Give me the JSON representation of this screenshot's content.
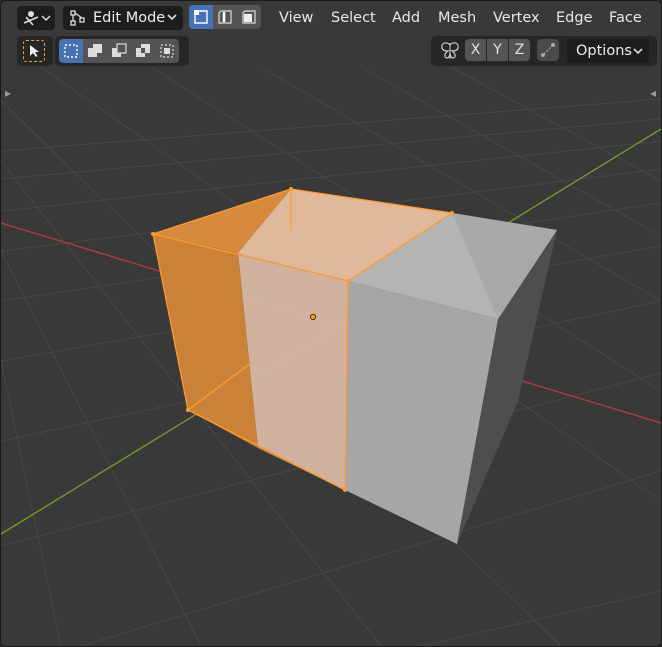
{
  "header": {
    "mode_label": "Edit Mode",
    "menus": [
      "View",
      "Select",
      "Add",
      "Mesh",
      "Vertex",
      "Edge",
      "Face"
    ]
  },
  "toolbar": {
    "axes": [
      "X",
      "Y",
      "Z"
    ],
    "options_label": "Options"
  },
  "icons": {
    "editor_type": "gizmo-icon",
    "mode": "edit-mode-icon",
    "select_modes": [
      "vertex-select-icon",
      "edge-select-icon",
      "face-select-icon"
    ],
    "active_tool": "cursor-select-icon",
    "selection_ops": [
      "select-box-icon",
      "extend-selection-icon",
      "subtract-selection-icon",
      "invert-selection-icon",
      "intersect-selection-icon"
    ],
    "mirror": "mirror-butterfly-icon",
    "snapping": "snapping-icon"
  },
  "colors": {
    "viewport_bg": "#393939",
    "grid_line": "#4a4a4a",
    "x_axis": "#b53a44",
    "y_axis": "#6e9a2e",
    "selection": "#ff9a2f",
    "mesh_face": "#a5a5a5",
    "ui_accent": "#4772b3"
  }
}
